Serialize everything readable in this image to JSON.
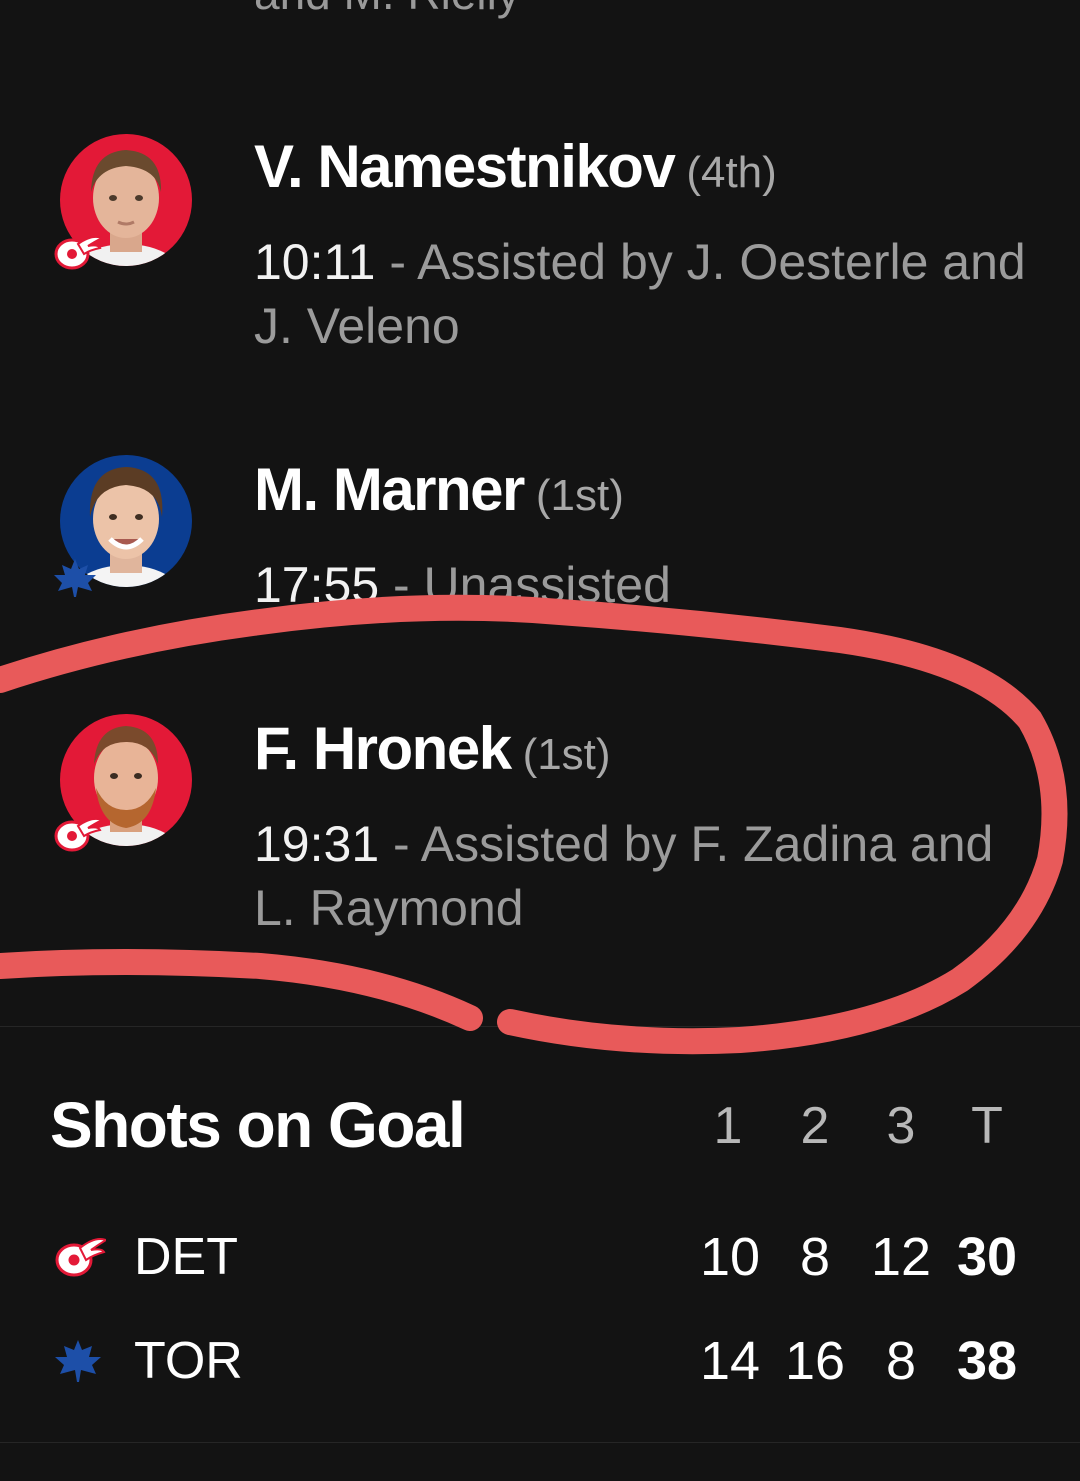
{
  "previous_goal": {
    "detail_tail": "and M. Rielly"
  },
  "goals": [
    {
      "scorer": "V. Namestnikov",
      "goal_count": "(4th)",
      "time": "10:11",
      "detail": " - Assisted by J. Oesterle and J. Veleno",
      "team": "DET",
      "team_color": "#e31937"
    },
    {
      "scorer": "M. Marner",
      "goal_count": "(1st)",
      "time": "17:55",
      "detail": " - Unassisted",
      "team": "TOR",
      "team_color": "#0b3d91"
    },
    {
      "scorer": "F. Hronek",
      "goal_count": "(1st)",
      "time": "19:31",
      "detail": " - Assisted by F. Zadina and L. Raymond",
      "team": "DET",
      "team_color": "#e31937"
    }
  ],
  "shots_on_goal": {
    "title": "Shots on Goal",
    "columns": [
      "1",
      "2",
      "3",
      "T"
    ],
    "rows": [
      {
        "team": "DET",
        "logo": "red-wings-logo-icon",
        "values": [
          "10",
          "8",
          "12",
          "30"
        ]
      },
      {
        "team": "TOR",
        "logo": "maple-leafs-logo-icon",
        "values": [
          "14",
          "16",
          "8",
          "38"
        ]
      }
    ]
  },
  "annotation": {
    "color": "#e85a5a",
    "shape": "hand-drawn loop around the F. Hronek goal entry"
  }
}
